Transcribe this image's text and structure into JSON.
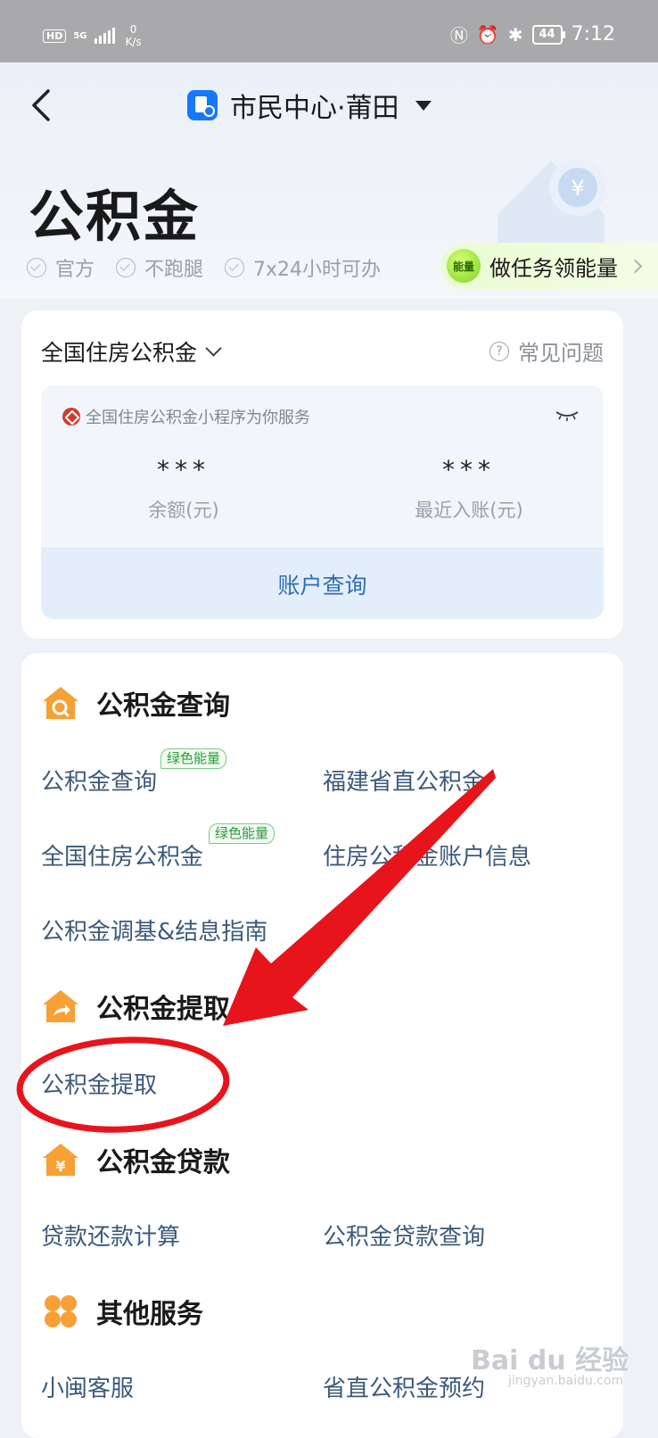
{
  "status_bar": {
    "hd": "HD",
    "network": "5G",
    "speed_value": "0",
    "speed_unit": "K/s",
    "battery": "44",
    "time": "7:12"
  },
  "header": {
    "title": "市民中心·莆田",
    "page_title": "公积金",
    "badges": [
      "官方",
      "不跑腿",
      "7x24小时可办"
    ],
    "energy_badge": "能量",
    "energy_task": "做任务领能量"
  },
  "account_card": {
    "selector": "全国住房公积金",
    "faq": "常见问题",
    "service_note": "全国住房公积金小程序为你服务",
    "balance_value": "***",
    "balance_label": "余额(元)",
    "recent_value": "***",
    "recent_label": "最近入账(元)",
    "query_button": "账户查询"
  },
  "sections": {
    "query": {
      "title": "公积金查询",
      "items": [
        "公积金查询",
        "福建省直公积金",
        "全国住房公积金",
        "住房公积金账户信息",
        "公积金调基&结息指南"
      ],
      "tag": "绿色能量"
    },
    "withdraw": {
      "title": "公积金提取",
      "items": [
        "公积金提取"
      ]
    },
    "loan": {
      "title": "公积金贷款",
      "items": [
        "贷款还款计算",
        "公积金贷款查询"
      ]
    },
    "other": {
      "title": "其他服务",
      "items": [
        "小闽客服",
        "省直公积金预约"
      ]
    }
  },
  "watermark": {
    "brand": "Bai du 经验",
    "url": "jingyan.baidu.com"
  },
  "colors": {
    "accent_blue": "#1677ff",
    "link_text": "#3c5a7a",
    "section_icon_orange": "#f7a035",
    "annotation_red": "#e8141b",
    "energy_green": "#7bd31a"
  }
}
